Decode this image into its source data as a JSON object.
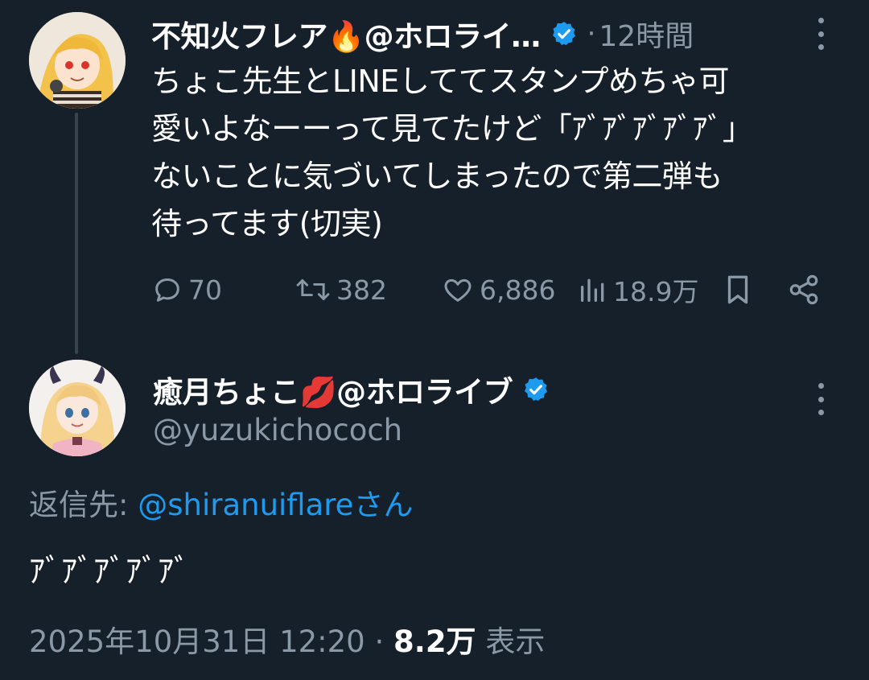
{
  "parent_tweet": {
    "display_name": "不知火フレア🔥@ホロライ…",
    "separator": "·",
    "time": "12時間",
    "text_lines": [
      "ちょこ先生とLINEしててスタンプめちゃ可",
      "愛いよなーーって見てたけど「ｱﾞｱﾞｱﾞｱﾞｱﾞ」",
      "ないことに気づいてしまったので第二弾も",
      "待ってます(切実)"
    ],
    "actions": {
      "replies": "70",
      "reposts": "382",
      "likes": "6,886",
      "views": "18.9万"
    }
  },
  "reply_tweet": {
    "display_name": "癒月ちょこ💋@ホロライブ",
    "handle": "@yuzukichococh",
    "reply_to_label": "返信先: ",
    "reply_to_mention": "@shiranuiflare",
    "reply_to_suffix": "さん",
    "text": "ｱﾞｱﾞｱﾞｱﾞｱﾞ",
    "timestamp": "2025年10月31日 12:20",
    "separator": " · ",
    "views_count": "8.2万",
    "views_label": " 表示"
  },
  "icons": {
    "verified": "verified-badge-icon",
    "more": "more-options-icon",
    "reply": "reply-icon",
    "repost": "repost-icon",
    "like": "like-icon",
    "views": "views-icon",
    "bookmark": "bookmark-icon",
    "share": "share-icon"
  },
  "colors": {
    "background": "#15202b",
    "text": "#ffffff",
    "secondary": "#8b98a5",
    "accent": "#1d9bf0",
    "thread_line": "#38444d"
  }
}
